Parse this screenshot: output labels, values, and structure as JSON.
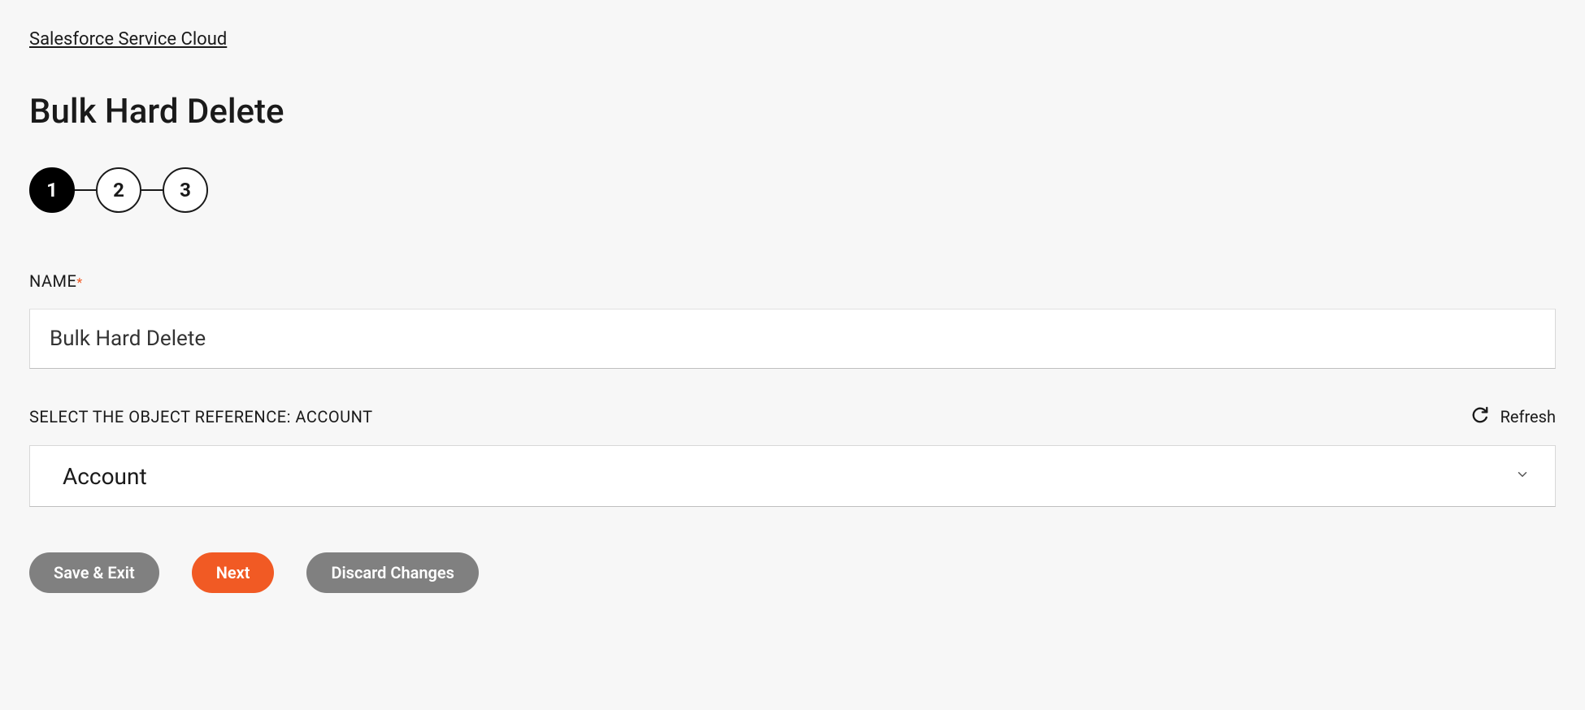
{
  "breadcrumb": "Salesforce Service Cloud",
  "page_title": "Bulk Hard Delete",
  "stepper": {
    "steps": [
      "1",
      "2",
      "3"
    ],
    "active_index": 0
  },
  "name_field": {
    "label": "NAME",
    "required": true,
    "value": "Bulk Hard Delete"
  },
  "object_ref": {
    "label": "SELECT THE OBJECT REFERENCE: ACCOUNT",
    "selected": "Account",
    "refresh_label": "Refresh"
  },
  "buttons": {
    "save_exit": "Save & Exit",
    "next": "Next",
    "discard": "Discard Changes"
  }
}
